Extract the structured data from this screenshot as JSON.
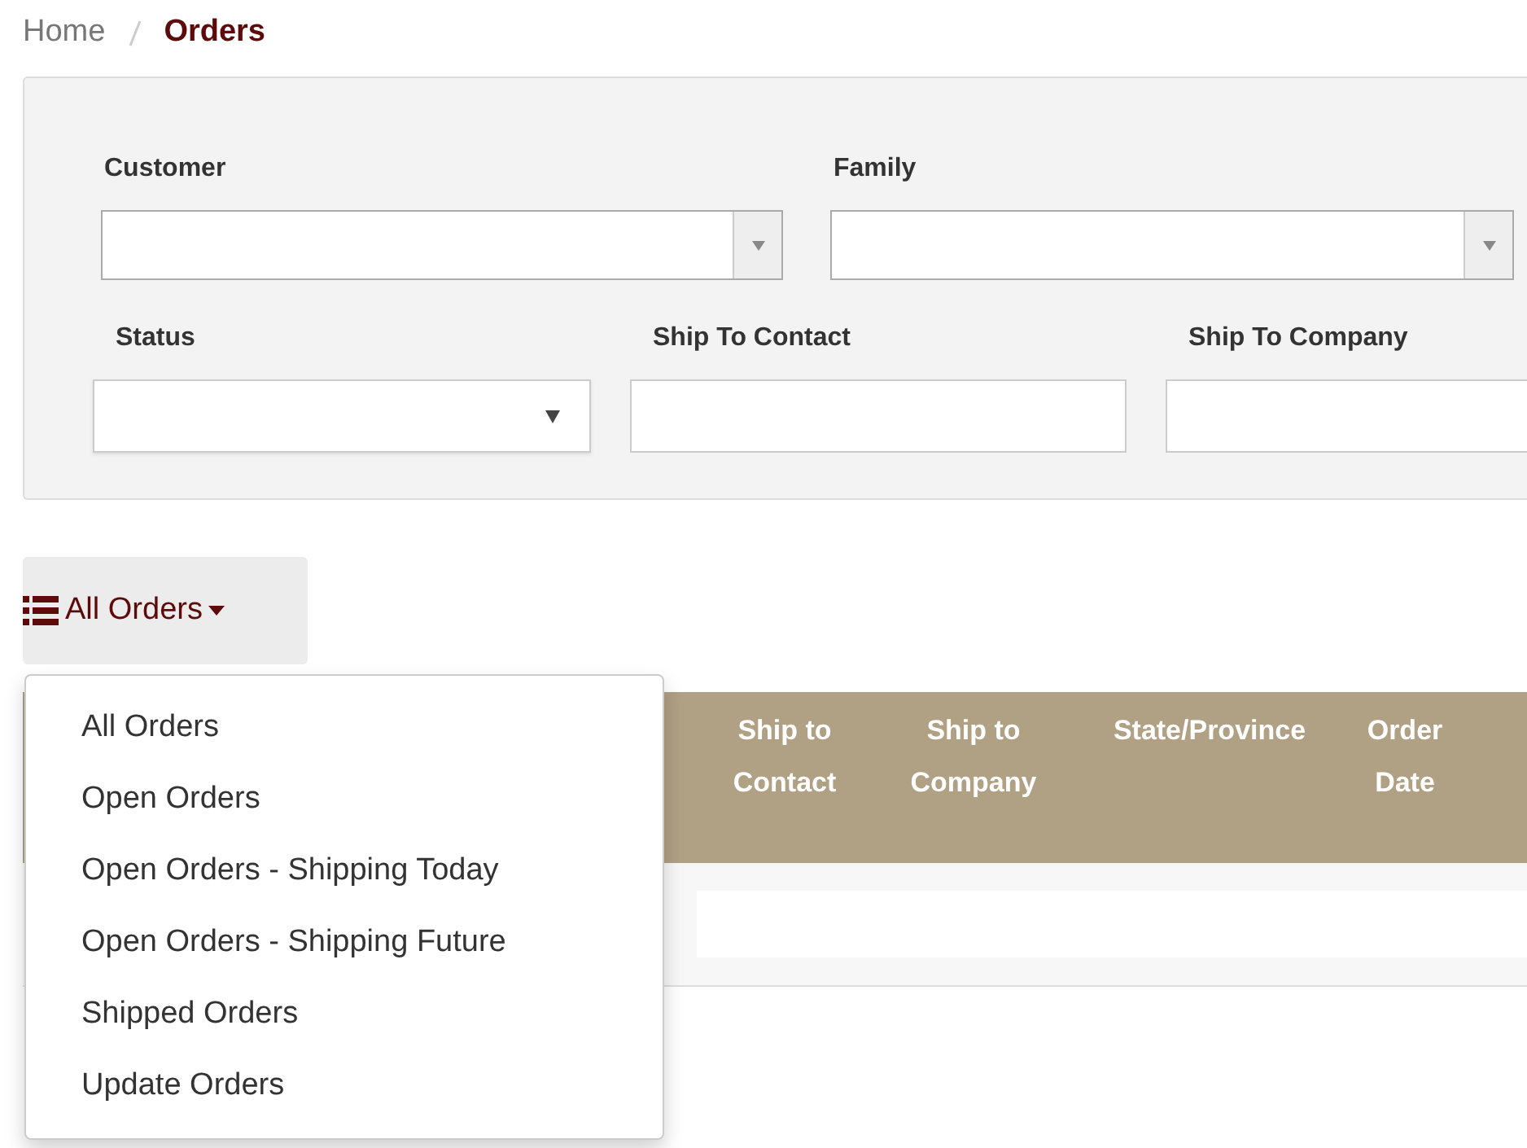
{
  "breadcrumb": [
    {
      "label": "Home",
      "current": false
    },
    {
      "label": "Orders",
      "current": true
    }
  ],
  "filters": [
    {
      "label": "Customer",
      "kind": "combo"
    },
    {
      "label": "Family",
      "kind": "combo"
    },
    {
      "label": "Status",
      "kind": "select"
    },
    {
      "label": "Ship To Contact",
      "kind": "text"
    },
    {
      "label": "Ship To Company",
      "kind": "text"
    }
  ],
  "view_menu": {
    "label": "All Orders",
    "expanded": true,
    "items": [
      "All Orders",
      "Open Orders",
      "Open Orders - Shipping Today",
      "Open Orders - Shipping Future",
      "Shipped Orders",
      "Update Orders"
    ]
  },
  "table": {
    "columns": [
      "Ship to Contact",
      "Ship to Company",
      "State/Province",
      "Order Date"
    ]
  }
}
